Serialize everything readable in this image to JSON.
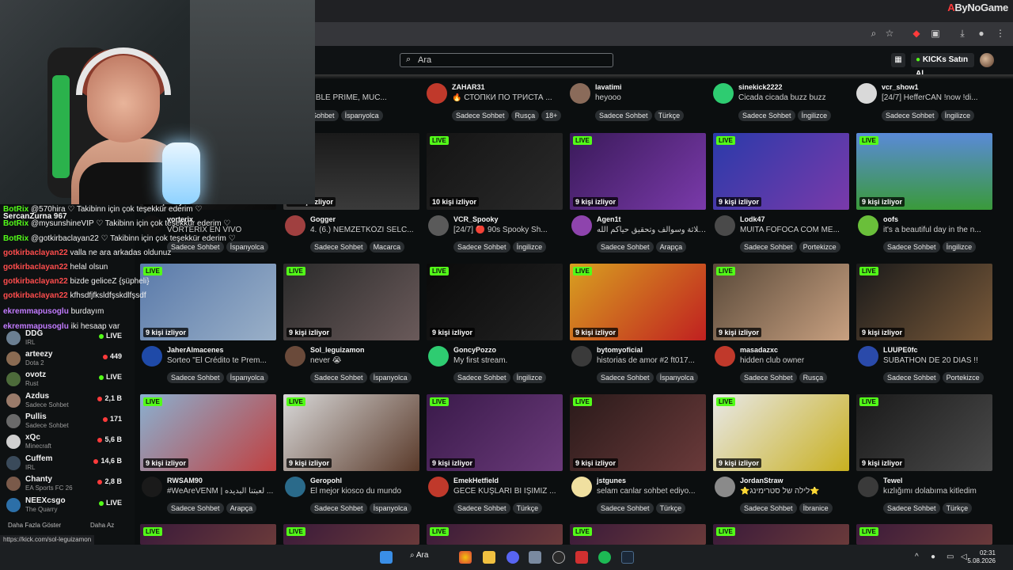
{
  "browser": {
    "brand": "ByNoGame",
    "brand_accent": "A"
  },
  "header": {
    "search_placeholder": "Ara",
    "buy_kicks_label": "KICKs Satın Al"
  },
  "chat": [
    {
      "user": "BotRix",
      "text": "@570hira ♡ Takibinn için çok teşekkür ederim ♡",
      "color": "#53fc18"
    },
    {
      "user": "SercanZurna",
      "text": "",
      "color": "#ffffff",
      "count": "967"
    },
    {
      "user": "BotRix",
      "text": "@mysunshineVIP ♡ Takibinn için çok teşekkür ederim ♡",
      "color": "#53fc18"
    },
    {
      "user": "BotRix",
      "text": "@gotkirbaclayan22 ♡ Takibinn için çok teşekkür ederim ♡",
      "color": "#53fc18"
    },
    {
      "user": "gotkirbaclayan22",
      "text": "valla ne ara arkadas oldunuz",
      "color": "#ff4d4d"
    },
    {
      "user": "gotkirbaclayan22",
      "text": "helal olsun",
      "color": "#ff4d4d"
    },
    {
      "user": "gotkirbaclayan22",
      "text": "bizde geliceZ {şüpheli}",
      "color": "#ff4d4d"
    },
    {
      "user": "gotkirbaclayan22",
      "text": "kfhsdfjfksldfşskdlfşsdf",
      "color": "#ff4d4d"
    },
    {
      "user": "ekremmapusoglu",
      "text": "burdayım",
      "color": "#c27bff"
    },
    {
      "user": "ekremmapusoglu",
      "text": "iki hesaap var",
      "color": "#c27bff"
    }
  ],
  "sidebar": {
    "items": [
      {
        "name": "DDG",
        "category": "IRL",
        "viewers": "LIVE",
        "color": "#6b7f92"
      },
      {
        "name": "arteezy",
        "category": "Dota 2",
        "viewers": "449",
        "color": "#8a6b52"
      },
      {
        "name": "ovotz",
        "category": "Rust",
        "viewers": "LIVE",
        "color": "#4d6b3a"
      },
      {
        "name": "Azdus",
        "category": "Sadece Sohbet",
        "viewers": "2,1 B",
        "color": "#9a7b6a"
      },
      {
        "name": "Pullis",
        "category": "Sadece Sohbet",
        "viewers": "171",
        "color": "#6a6a6a"
      },
      {
        "name": "xQc",
        "category": "Minecraft",
        "viewers": "5,6 B",
        "color": "#d0d0d0"
      },
      {
        "name": "Cuffem",
        "category": "IRL",
        "viewers": "14,6 B",
        "color": "#3a4a5a"
      },
      {
        "name": "Chanty",
        "category": "EA Sports FC 26",
        "viewers": "2,8 B",
        "color": "#7a5a4a"
      },
      {
        "name": "NEEXcsgo",
        "category": "The Quarry",
        "viewers": "LIVE",
        "color": "#2c6fa8"
      }
    ],
    "show_more": "Daha Fazla Göster",
    "show_less": "Daha Az"
  },
  "top_row": [
    {
      "name": "ysfredy",
      "title": "EXTENSIBLE PRIME, MUC...",
      "tags": [
        "Sadece Sohbet",
        "İspanyolca"
      ],
      "avatar": "#3a3a3a"
    },
    {
      "name": "ZAHAR31",
      "title": "🔥 СТОПКИ ПО ТРИСТА ...",
      "tags": [
        "Sadece Sohbet",
        "Rusça",
        "18+"
      ],
      "avatar": "#c0392b"
    },
    {
      "name": "lavatimi",
      "title": "heyooo",
      "tags": [
        "Sadece Sohbet",
        "Türkçe"
      ],
      "avatar": "#8a6b5a"
    },
    {
      "name": "sinekick2222",
      "title": "Cicada cicada buzz buzz",
      "tags": [
        "Sadece Sohbet",
        "İngilizce"
      ],
      "avatar": "#2ecc71"
    },
    {
      "name": "vcr_show1",
      "title": "[24/7] HefferCAN !now !di...",
      "tags": [
        "Sadece Sohbet",
        "İngilizce"
      ],
      "avatar": "#d9d9d9"
    }
  ],
  "rows": [
    [
      {
        "name": "vorterix",
        "title": "VORTERIX EN VIVO",
        "tags": [
          "Sadece Sohbet",
          "İspanyolca"
        ],
        "viewers": "10 kişi izliyor",
        "live": false,
        "avatar": "#111111",
        "thumb": "linear-gradient(135deg,#202020,#0a0a0a)"
      },
      {
        "name": "Gogger",
        "title": "4. (6.) NEMZETKÖZI SELC...",
        "tags": [
          "Sadece Sohbet",
          "Macarca"
        ],
        "viewers": "10 kişi izliyor",
        "live": false,
        "avatar": "#a04040",
        "thumb": "linear-gradient(180deg,#1a1a1a,#3a3a3a)"
      },
      {
        "name": "VCR_Spooky",
        "title": "[24/7] 🔴 90s Spooky Sh...",
        "tags": [
          "Sadece Sohbet",
          "İngilizce"
        ],
        "viewers": "10 kişi izliyor",
        "live": true,
        "avatar": "#5a5a5a",
        "thumb": "linear-gradient(135deg,#141414,#2a2a2a)"
      },
      {
        "name": "Agen1t",
        "title": "ثلاثة وسوالف وتحقيق حياكم الله || ...",
        "tags": [
          "Sadece Sohbet",
          "Arapça"
        ],
        "viewers": "9 kişi izliyor",
        "live": true,
        "avatar": "#8e44ad",
        "thumb": "linear-gradient(135deg,#3a1a5a,#7a3aaa)"
      },
      {
        "name": "Lodk47",
        "title": "MUITA FOFOCA COM ME...",
        "tags": [
          "Sadece Sohbet",
          "Portekizce"
        ],
        "viewers": "9 kişi izliyor",
        "live": true,
        "avatar": "#4a4a4a",
        "thumb": "linear-gradient(135deg,#2a3aaa,#7a3aaa)"
      },
      {
        "name": "oofs",
        "title": "it's a beautiful day in the n...",
        "tags": [
          "Sadece Sohbet",
          "İngilizce"
        ],
        "viewers": "9 kişi izliyor",
        "live": true,
        "avatar": "#6abf3a",
        "thumb": "linear-gradient(180deg,#5a8ad8,#3a9a3a)"
      }
    ],
    [
      {
        "name": "JaherAlmacenes",
        "title": "Sorteo \"El Crédito te Prem...",
        "tags": [
          "Sadece Sohbet",
          "İspanyolca"
        ],
        "viewers": "9 kişi izliyor",
        "live": true,
        "avatar": "#1f4aa8",
        "thumb": "linear-gradient(135deg,#5a7aaa,#9ab0c8)"
      },
      {
        "name": "Sol_leguizamon",
        "title": "never 😭",
        "tags": [
          "Sadece Sohbet",
          "İspanyolca"
        ],
        "viewers": "9 kişi izliyor",
        "live": true,
        "avatar": "#6a4a3a",
        "thumb": "linear-gradient(135deg,#2a2a2a,#6a5a5a)"
      },
      {
        "name": "GoncyPozzo",
        "title": "My first stream.",
        "tags": [
          "Sadece Sohbet",
          "İngilizce"
        ],
        "viewers": "9 kişi izliyor",
        "live": true,
        "avatar": "#2ecc71",
        "thumb": "linear-gradient(135deg,#0a0a0a,#222222)"
      },
      {
        "name": "bytomyoficial",
        "title": "historias de amor #2 ft017...",
        "tags": [
          "Sadece Sohbet",
          "İspanyolca"
        ],
        "viewers": "9 kişi izliyor",
        "live": true,
        "avatar": "#3a3a3a",
        "thumb": "linear-gradient(135deg,#d8a020,#c02020)"
      },
      {
        "name": "masadazxc",
        "title": "hidden club owner",
        "tags": [
          "Sadece Sohbet",
          "Rusça"
        ],
        "viewers": "9 kişi izliyor",
        "live": true,
        "avatar": "#c0392b",
        "thumb": "linear-gradient(135deg,#5a4a3a,#c8a080)"
      },
      {
        "name": "LUUPE0fc",
        "title": "SUBATHON DE 20 DIAS !!",
        "tags": [
          "Sadece Sohbet",
          "Portekizce"
        ],
        "viewers": "9 kişi izliyor",
        "live": true,
        "avatar": "#2a4aaa",
        "thumb": "linear-gradient(135deg,#1a1a1a,#7a5a3a)"
      }
    ],
    [
      {
        "name": "RWSAM90",
        "title": "#WeAreVENM | لعبتنا البديده ...",
        "tags": [
          "Sadece Sohbet",
          "Arapça"
        ],
        "viewers": "9 kişi izliyor",
        "live": true,
        "avatar": "#1a1a1a",
        "thumb": "linear-gradient(135deg,#8ab0d0,#c04040)"
      },
      {
        "name": "Geropohl",
        "title": "El mejor kiosco du mundo",
        "tags": [
          "Sadece Sohbet",
          "İspanyolca"
        ],
        "viewers": "9 kişi izliyor",
        "live": true,
        "avatar": "#2a6a8a",
        "thumb": "linear-gradient(135deg,#d8d8d8,#5a3a2a)"
      },
      {
        "name": "EmekHetfield",
        "title": "GECE KUŞLARI Bİ İŞİMİZ ...",
        "tags": [
          "Sadece Sohbet",
          "Türkçe"
        ],
        "viewers": "9 kişi izliyor",
        "live": true,
        "avatar": "#c0392b",
        "thumb": "linear-gradient(135deg,#3a1a4a,#6a3a7a)"
      },
      {
        "name": "jstgunes",
        "title": "selam canlar sohbet ediyo...",
        "tags": [
          "Sadece Sohbet",
          "Türkçe"
        ],
        "viewers": "9 kişi izliyor",
        "live": true,
        "avatar": "#f0e0a0",
        "thumb": "linear-gradient(135deg,#2a1a1a,#6a3a3a)"
      },
      {
        "name": "JordanStraw",
        "title": "⭐לילה של סטרימינג⭐",
        "tags": [
          "Sadece Sohbet",
          "İbranice"
        ],
        "viewers": "9 kişi izliyor",
        "live": true,
        "avatar": "#8a8a8a",
        "thumb": "linear-gradient(135deg,#e8e8e8,#c8b020)"
      },
      {
        "name": "Tewel",
        "title": "kızlığımı dolabıma kitledim",
        "tags": [
          "Sadece Sohbet",
          "Türkçe"
        ],
        "viewers": "9 kişi izliyor",
        "live": true,
        "avatar": "#3a3a3a",
        "thumb": "linear-gradient(135deg,#1a1a1a,#4a4a4a)"
      }
    ]
  ],
  "status_url": "https://kick.com/sol-leguizamon",
  "taskbar": {
    "search_label": "Ara",
    "time": "02:31",
    "date": "5.08.2026"
  }
}
